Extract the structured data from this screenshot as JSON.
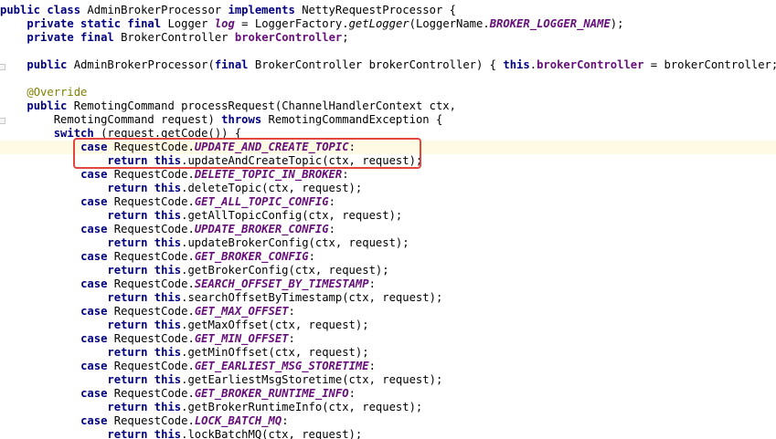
{
  "editor": {
    "highlight_color": "#e2463c",
    "colors": {
      "keyword": "#000080",
      "field": "#660e7a",
      "annotation": "#808000",
      "current_line": "#fffae3"
    },
    "lines": [
      {
        "indent": "",
        "tokens": [
          {
            "t": "kw",
            "v": "public class "
          },
          {
            "t": "plain",
            "v": "AdminBrokerProcessor "
          },
          {
            "t": "kw",
            "v": "implements "
          },
          {
            "t": "plain",
            "v": "NettyRequestProcessor {"
          }
        ]
      },
      {
        "indent": "    ",
        "tokens": [
          {
            "t": "kw",
            "v": "private static final "
          },
          {
            "t": "plain",
            "v": "Logger "
          },
          {
            "t": "static-field",
            "v": "log"
          },
          {
            "t": "plain",
            "v": " = LoggerFactory."
          },
          {
            "t": "static-call",
            "v": "getLogger"
          },
          {
            "t": "plain",
            "v": "(LoggerName."
          },
          {
            "t": "static-field",
            "v": "BROKER_LOGGER_NAME"
          },
          {
            "t": "plain",
            "v": ");"
          }
        ]
      },
      {
        "indent": "    ",
        "tokens": [
          {
            "t": "kw",
            "v": "private final "
          },
          {
            "t": "plain",
            "v": "BrokerController "
          },
          {
            "t": "field",
            "v": "brokerController"
          },
          {
            "t": "plain",
            "v": ";"
          }
        ]
      },
      {
        "indent": "",
        "tokens": []
      },
      {
        "indent": "    ",
        "tokens": [
          {
            "t": "kw",
            "v": "public "
          },
          {
            "t": "plain",
            "v": "AdminBrokerProcessor("
          },
          {
            "t": "kw",
            "v": "final "
          },
          {
            "t": "plain",
            "v": "BrokerController brokerController) { "
          },
          {
            "t": "kw",
            "v": "this"
          },
          {
            "t": "plain",
            "v": "."
          },
          {
            "t": "field",
            "v": "brokerController"
          },
          {
            "t": "plain",
            "v": " = brokerController; }"
          }
        ]
      },
      {
        "indent": "",
        "tokens": []
      },
      {
        "indent": "    ",
        "tokens": [
          {
            "t": "annot",
            "v": "@Override"
          }
        ]
      },
      {
        "indent": "    ",
        "tokens": [
          {
            "t": "kw",
            "v": "public "
          },
          {
            "t": "plain",
            "v": "RemotingCommand processRequest(ChannelHandlerContext ctx,"
          }
        ]
      },
      {
        "indent": "        ",
        "tokens": [
          {
            "t": "plain",
            "v": "RemotingCommand request) "
          },
          {
            "t": "kw",
            "v": "throws "
          },
          {
            "t": "plain",
            "v": "RemotingCommandException {"
          }
        ]
      },
      {
        "indent": "        ",
        "tokens": [
          {
            "t": "kw",
            "v": "switch "
          },
          {
            "t": "plain",
            "v": "(request.getCode()) {"
          }
        ]
      },
      {
        "indent": "            ",
        "current": true,
        "tokens": [
          {
            "t": "kw",
            "v": "case "
          },
          {
            "t": "plain",
            "v": "RequestCode."
          },
          {
            "t": "static-field",
            "v": "UPDATE_AND_CREATE_TOPIC"
          },
          {
            "t": "plain",
            "v": ":"
          }
        ]
      },
      {
        "indent": "                ",
        "tokens": [
          {
            "t": "kw",
            "v": "return this"
          },
          {
            "t": "plain",
            "v": ".updateAndCreateTopic(ctx, request);"
          }
        ]
      },
      {
        "indent": "            ",
        "tokens": [
          {
            "t": "kw",
            "v": "case "
          },
          {
            "t": "plain",
            "v": "RequestCode."
          },
          {
            "t": "static-field",
            "v": "DELETE_TOPIC_IN_BROKER"
          },
          {
            "t": "plain",
            "v": ":"
          }
        ]
      },
      {
        "indent": "                ",
        "tokens": [
          {
            "t": "kw",
            "v": "return this"
          },
          {
            "t": "plain",
            "v": ".deleteTopic(ctx, request);"
          }
        ]
      },
      {
        "indent": "            ",
        "tokens": [
          {
            "t": "kw",
            "v": "case "
          },
          {
            "t": "plain",
            "v": "RequestCode."
          },
          {
            "t": "static-field",
            "v": "GET_ALL_TOPIC_CONFIG"
          },
          {
            "t": "plain",
            "v": ":"
          }
        ]
      },
      {
        "indent": "                ",
        "tokens": [
          {
            "t": "kw",
            "v": "return this"
          },
          {
            "t": "plain",
            "v": ".getAllTopicConfig(ctx, request);"
          }
        ]
      },
      {
        "indent": "            ",
        "tokens": [
          {
            "t": "kw",
            "v": "case "
          },
          {
            "t": "plain",
            "v": "RequestCode."
          },
          {
            "t": "static-field",
            "v": "UPDATE_BROKER_CONFIG"
          },
          {
            "t": "plain",
            "v": ":"
          }
        ]
      },
      {
        "indent": "                ",
        "tokens": [
          {
            "t": "kw",
            "v": "return this"
          },
          {
            "t": "plain",
            "v": ".updateBrokerConfig(ctx, request);"
          }
        ]
      },
      {
        "indent": "            ",
        "tokens": [
          {
            "t": "kw",
            "v": "case "
          },
          {
            "t": "plain",
            "v": "RequestCode."
          },
          {
            "t": "static-field",
            "v": "GET_BROKER_CONFIG"
          },
          {
            "t": "plain",
            "v": ":"
          }
        ]
      },
      {
        "indent": "                ",
        "tokens": [
          {
            "t": "kw",
            "v": "return this"
          },
          {
            "t": "plain",
            "v": ".getBrokerConfig(ctx, request);"
          }
        ]
      },
      {
        "indent": "            ",
        "tokens": [
          {
            "t": "kw",
            "v": "case "
          },
          {
            "t": "plain",
            "v": "RequestCode."
          },
          {
            "t": "static-field",
            "v": "SEARCH_OFFSET_BY_TIMESTAMP"
          },
          {
            "t": "plain",
            "v": ":"
          }
        ]
      },
      {
        "indent": "                ",
        "tokens": [
          {
            "t": "kw",
            "v": "return this"
          },
          {
            "t": "plain",
            "v": ".searchOffsetByTimestamp(ctx, request);"
          }
        ]
      },
      {
        "indent": "            ",
        "tokens": [
          {
            "t": "kw",
            "v": "case "
          },
          {
            "t": "plain",
            "v": "RequestCode."
          },
          {
            "t": "static-field",
            "v": "GET_MAX_OFFSET"
          },
          {
            "t": "plain",
            "v": ":"
          }
        ]
      },
      {
        "indent": "                ",
        "tokens": [
          {
            "t": "kw",
            "v": "return this"
          },
          {
            "t": "plain",
            "v": ".getMaxOffset(ctx, request);"
          }
        ]
      },
      {
        "indent": "            ",
        "tokens": [
          {
            "t": "kw",
            "v": "case "
          },
          {
            "t": "plain",
            "v": "RequestCode."
          },
          {
            "t": "static-field",
            "v": "GET_MIN_OFFSET"
          },
          {
            "t": "plain",
            "v": ":"
          }
        ]
      },
      {
        "indent": "                ",
        "tokens": [
          {
            "t": "kw",
            "v": "return this"
          },
          {
            "t": "plain",
            "v": ".getMinOffset(ctx, request);"
          }
        ]
      },
      {
        "indent": "            ",
        "tokens": [
          {
            "t": "kw",
            "v": "case "
          },
          {
            "t": "plain",
            "v": "RequestCode."
          },
          {
            "t": "static-field",
            "v": "GET_EARLIEST_MSG_STORETIME"
          },
          {
            "t": "plain",
            "v": ":"
          }
        ]
      },
      {
        "indent": "                ",
        "tokens": [
          {
            "t": "kw",
            "v": "return this"
          },
          {
            "t": "plain",
            "v": ".getEarliestMsgStoretime(ctx, request);"
          }
        ]
      },
      {
        "indent": "            ",
        "tokens": [
          {
            "t": "kw",
            "v": "case "
          },
          {
            "t": "plain",
            "v": "RequestCode."
          },
          {
            "t": "static-field",
            "v": "GET_BROKER_RUNTIME_INFO"
          },
          {
            "t": "plain",
            "v": ":"
          }
        ]
      },
      {
        "indent": "                ",
        "tokens": [
          {
            "t": "kw",
            "v": "return this"
          },
          {
            "t": "plain",
            "v": ".getBrokerRuntimeInfo(ctx, request);"
          }
        ]
      },
      {
        "indent": "            ",
        "tokens": [
          {
            "t": "kw",
            "v": "case "
          },
          {
            "t": "plain",
            "v": "RequestCode."
          },
          {
            "t": "static-field",
            "v": "LOCK_BATCH_MQ"
          },
          {
            "t": "plain",
            "v": ":"
          }
        ]
      },
      {
        "indent": "                ",
        "tokens": [
          {
            "t": "kw",
            "v": "return this"
          },
          {
            "t": "plain",
            "v": ".lockBatchMQ(ctx, request);"
          }
        ]
      }
    ]
  }
}
